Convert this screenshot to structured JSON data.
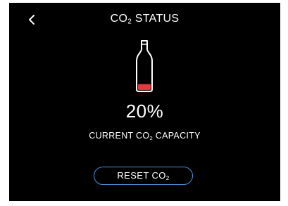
{
  "header": {
    "back_icon": "chevron-left-icon",
    "title_main": "CO",
    "title_sub": "2",
    "title_rest": " STATUS"
  },
  "status": {
    "capacity_percent": 20,
    "capacity_label": "20%",
    "bottle_icon": "co2-bottle-icon",
    "fill_color": "#e53940",
    "caption_pre": "CURRENT CO",
    "caption_sub": "2",
    "caption_post": " CAPACITY"
  },
  "actions": {
    "reset_pre": "RESET CO",
    "reset_sub": "2",
    "reset_border_color": "#4f93d8"
  }
}
